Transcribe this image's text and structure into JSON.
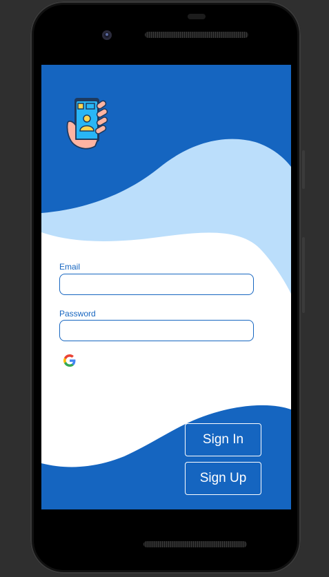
{
  "form": {
    "email_label": "Email",
    "email_value": "",
    "password_label": "Password",
    "password_value": ""
  },
  "buttons": {
    "sign_in": "Sign In",
    "sign_up": "Sign Up"
  },
  "icons": {
    "app_logo": "hand-holding-phone-icon",
    "google": "google-icon"
  },
  "colors": {
    "primary": "#1565c0",
    "light_wave": "#bbdefb",
    "surface": "#ffffff"
  }
}
